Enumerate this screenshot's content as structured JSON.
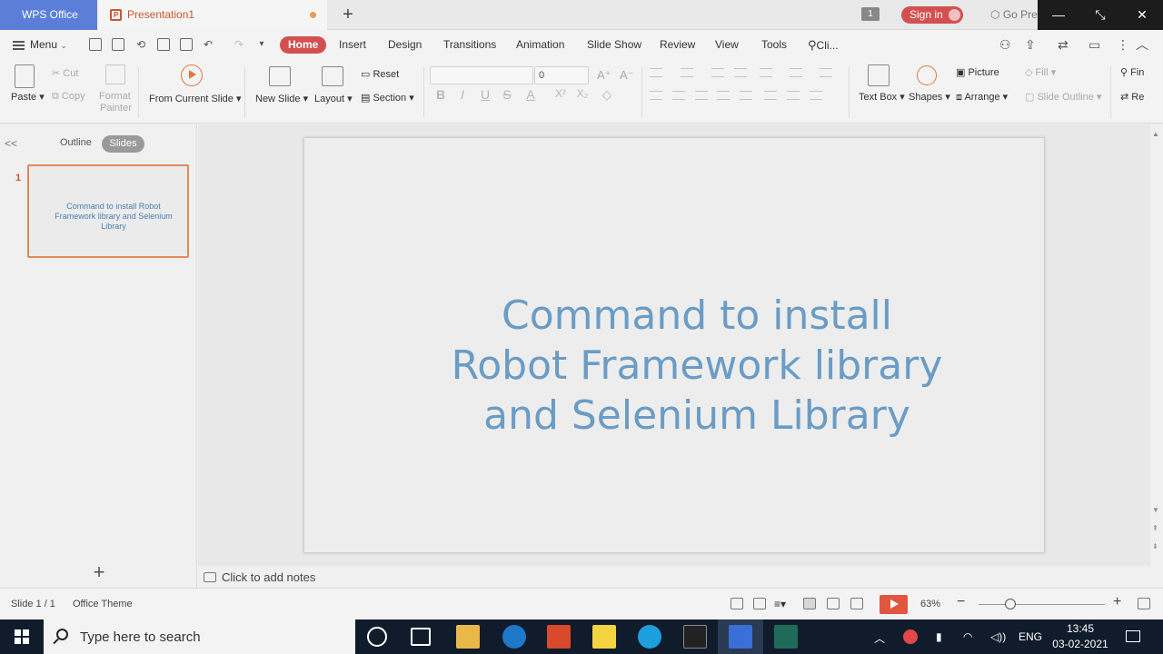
{
  "titlebar": {
    "app_tab": "WPS Office",
    "doc_tab": "Presentation1",
    "new_tab_glyph": "+",
    "badge_count": "1",
    "signin_label": "Sign in",
    "go_pre_label": "Go Pre",
    "min_glyph": "—",
    "restore_glyph": "⤡",
    "close_glyph": "✕"
  },
  "menurow": {
    "menu_label": "Menu",
    "tabs": [
      "Home",
      "Insert",
      "Design",
      "Transitions",
      "Animation",
      "Slide Show",
      "Review",
      "View",
      "Tools"
    ],
    "active_tab": "Home",
    "search_label": "Cli..."
  },
  "ribbon": {
    "paste": "Paste",
    "cut": "Cut",
    "copy": "Copy",
    "format_painter_1": "Format",
    "format_painter_2": "Painter",
    "from_current_slide": "From Current Slide",
    "new_slide": "New Slide",
    "layout": "Layout",
    "reset": "Reset",
    "section": "Section",
    "font_name": "",
    "font_size": "0",
    "text_box": "Text Box",
    "shapes": "Shapes",
    "picture": "Picture",
    "arrange": "Arrange",
    "fill": "Fill",
    "slide_outline": "Slide Outline",
    "find": "Fin",
    "replace": "Re"
  },
  "leftpanel": {
    "collapse_glyph": "<<",
    "outline_tab": "Outline",
    "slides_tab": "Slides",
    "slide_number": "1",
    "thumb_title": "Command to install Robot Framework library and Selenium Library",
    "add_glyph": "+"
  },
  "slide": {
    "title": "Command to install Robot Framework library and Selenium Library"
  },
  "notes": {
    "placeholder": "Click to add notes"
  },
  "statusbar": {
    "slide_counter": "Slide 1 / 1",
    "theme": "Office Theme",
    "zoom": "63%",
    "zoom_level_fraction": 0.25
  },
  "taskbar": {
    "search_placeholder": "Type here to search",
    "language": "ENG",
    "time": "13:45",
    "date": "03-02-2021"
  },
  "colors": {
    "accent_red": "#d35050",
    "wps_blue": "#5b7fd9",
    "title_blue": "#6a9cc6",
    "taskbar": "#101c2c"
  }
}
